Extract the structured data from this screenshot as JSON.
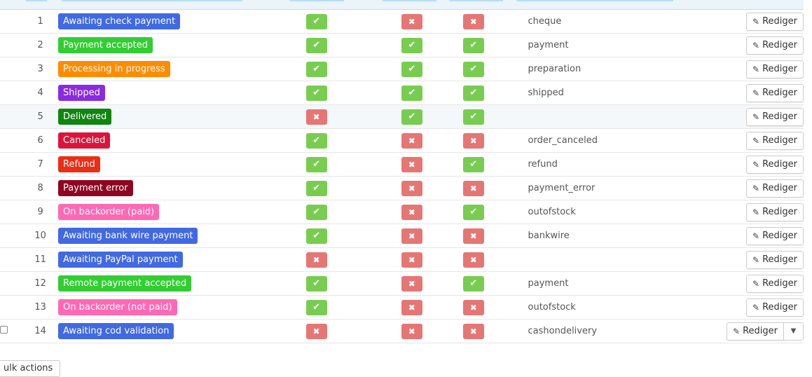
{
  "colors": {
    "blue": "#4169e1",
    "green": "#32cd32",
    "orange": "#ff8c00",
    "purple": "#8a2be2",
    "darkgreen": "#108510",
    "crimson": "#dc143c",
    "red": "#ec2e15",
    "darkred": "#8f0621",
    "pink": "#ff69b4",
    "icon_yes": "#78cd51",
    "icon_no": "#e57674"
  },
  "edit_label": "Rediger",
  "bulk_label": "ulk actions",
  "rows": [
    {
      "id": "1",
      "name": "Awaiting check payment",
      "color": "blue",
      "i1": "yes",
      "i2": "no",
      "i3": "no",
      "template": "cheque"
    },
    {
      "id": "2",
      "name": "Payment accepted",
      "color": "green",
      "i1": "yes",
      "i2": "yes",
      "i3": "yes",
      "template": "payment"
    },
    {
      "id": "3",
      "name": "Processing in progress",
      "color": "orange",
      "i1": "yes",
      "i2": "yes",
      "i3": "yes",
      "template": "preparation"
    },
    {
      "id": "4",
      "name": "Shipped",
      "color": "purple",
      "i1": "yes",
      "i2": "yes",
      "i3": "yes",
      "template": "shipped"
    },
    {
      "id": "5",
      "name": "Delivered",
      "color": "darkgreen",
      "i1": "no",
      "i2": "yes",
      "i3": "yes",
      "template": ""
    },
    {
      "id": "6",
      "name": "Canceled",
      "color": "crimson",
      "i1": "yes",
      "i2": "no",
      "i3": "no",
      "template": "order_canceled"
    },
    {
      "id": "7",
      "name": "Refund",
      "color": "red",
      "i1": "yes",
      "i2": "no",
      "i3": "yes",
      "template": "refund"
    },
    {
      "id": "8",
      "name": "Payment error",
      "color": "darkred",
      "i1": "yes",
      "i2": "no",
      "i3": "no",
      "template": "payment_error"
    },
    {
      "id": "9",
      "name": "On backorder (paid)",
      "color": "pink",
      "i1": "yes",
      "i2": "no",
      "i3": "yes",
      "template": "outofstock"
    },
    {
      "id": "10",
      "name": "Awaiting bank wire payment",
      "color": "blue",
      "i1": "yes",
      "i2": "no",
      "i3": "no",
      "template": "bankwire"
    },
    {
      "id": "11",
      "name": "Awaiting PayPal payment",
      "color": "blue",
      "i1": "no",
      "i2": "no",
      "i3": "no",
      "template": ""
    },
    {
      "id": "12",
      "name": "Remote payment accepted",
      "color": "green",
      "i1": "yes",
      "i2": "no",
      "i3": "yes",
      "template": "payment"
    },
    {
      "id": "13",
      "name": "On backorder (not paid)",
      "color": "pink",
      "i1": "yes",
      "i2": "no",
      "i3": "no",
      "template": "outofstock"
    },
    {
      "id": "14",
      "name": "Awaiting cod validation",
      "color": "blue",
      "i1": "no",
      "i2": "no",
      "i3": "no",
      "template": "cashondelivery"
    }
  ]
}
